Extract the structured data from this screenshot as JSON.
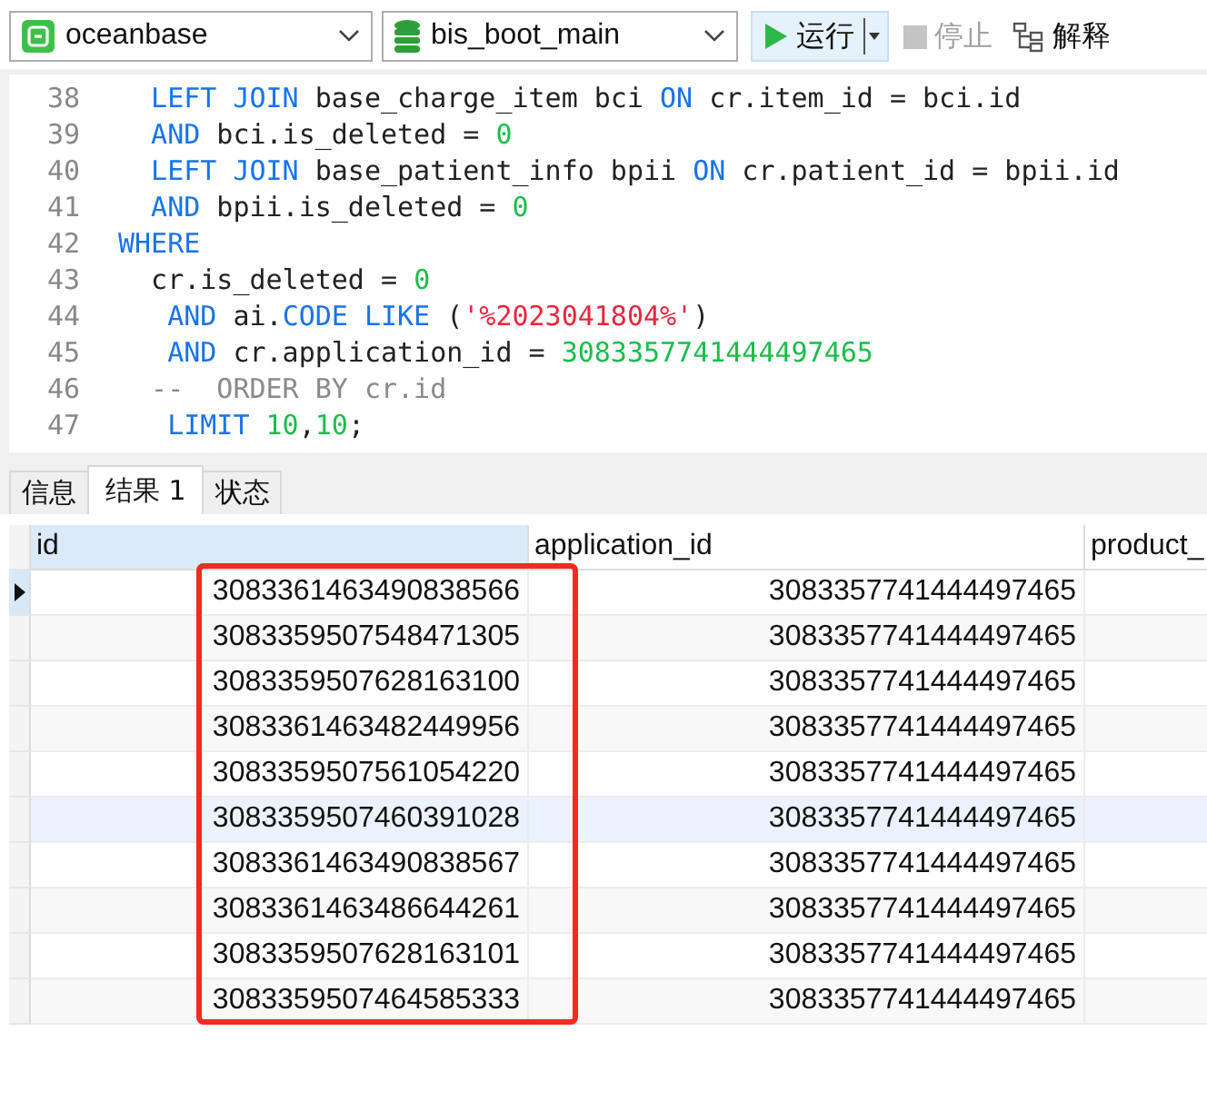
{
  "toolbar": {
    "connection": "oceanbase",
    "database": "bis_boot_main",
    "buttons": [
      {
        "kind": "run",
        "label": "运行",
        "disabled": false
      },
      {
        "kind": "stop",
        "label": "停止",
        "disabled": true
      },
      {
        "kind": "explain",
        "label": "解释",
        "disabled": false
      }
    ]
  },
  "editor": {
    "lines": [
      {
        "number": "38",
        "tokens": [
          {
            "kind": "kw",
            "text": "  LEFT JOIN"
          },
          {
            "kind": "plain",
            "text": " base_charge_item bci "
          },
          {
            "kind": "kw",
            "text": "ON"
          },
          {
            "kind": "plain",
            "text": " cr.item_id = bci.id"
          }
        ]
      },
      {
        "number": "39",
        "tokens": [
          {
            "kind": "kw",
            "text": "  AND"
          },
          {
            "kind": "plain",
            "text": " bci.is_deleted = "
          },
          {
            "kind": "num",
            "text": "0"
          }
        ]
      },
      {
        "number": "40",
        "tokens": [
          {
            "kind": "kw",
            "text": "  LEFT JOIN"
          },
          {
            "kind": "plain",
            "text": " base_patient_info bpii "
          },
          {
            "kind": "kw",
            "text": "ON"
          },
          {
            "kind": "plain",
            "text": " cr.patient_id = bpii.id"
          }
        ]
      },
      {
        "number": "41",
        "tokens": [
          {
            "kind": "kw",
            "text": "  AND"
          },
          {
            "kind": "plain",
            "text": " bpii.is_deleted = "
          },
          {
            "kind": "num",
            "text": "0"
          }
        ]
      },
      {
        "number": "42",
        "tokens": [
          {
            "kind": "kw",
            "text": "WHERE"
          }
        ]
      },
      {
        "number": "43",
        "tokens": [
          {
            "kind": "plain",
            "text": "  cr.is_deleted = "
          },
          {
            "kind": "num",
            "text": "0"
          }
        ]
      },
      {
        "number": "44",
        "tokens": [
          {
            "kind": "kw",
            "text": "   AND"
          },
          {
            "kind": "plain",
            "text": " ai."
          },
          {
            "kind": "kw",
            "text": "CODE LIKE"
          },
          {
            "kind": "plain",
            "text": " ("
          },
          {
            "kind": "str",
            "text": "'%2023041804%'"
          },
          {
            "kind": "plain",
            "text": ")"
          }
        ]
      },
      {
        "number": "45",
        "tokens": [
          {
            "kind": "kw",
            "text": "   AND"
          },
          {
            "kind": "plain",
            "text": " cr.application_id = "
          },
          {
            "kind": "num",
            "text": "3083357741444497465"
          }
        ]
      },
      {
        "number": "46",
        "tokens": [
          {
            "kind": "comment",
            "text": "  --  ORDER BY cr.id"
          }
        ]
      },
      {
        "number": "47",
        "tokens": [
          {
            "kind": "kw",
            "text": "   LIMIT "
          },
          {
            "kind": "num",
            "text": "10"
          },
          {
            "kind": "plain",
            "text": ","
          },
          {
            "kind": "num",
            "text": "10"
          },
          {
            "kind": "plain",
            "text": ";"
          }
        ]
      }
    ]
  },
  "tabs": [
    {
      "label": "信息",
      "selected": false
    },
    {
      "label": "结果 1",
      "selected": true
    },
    {
      "label": "状态",
      "selected": false
    }
  ],
  "table": {
    "columns": [
      {
        "label": "id",
        "selected": true
      },
      {
        "label": "application_id",
        "selected": false
      },
      {
        "label": "product_",
        "selected": false
      }
    ],
    "rows": [
      {
        "selected": true,
        "hovered": false,
        "cells": [
          "3083361463490838566",
          "3083357741444497465"
        ]
      },
      {
        "selected": false,
        "hovered": false,
        "cells": [
          "3083359507548471305",
          "3083357741444497465"
        ]
      },
      {
        "selected": false,
        "hovered": false,
        "cells": [
          "3083359507628163100",
          "3083357741444497465"
        ]
      },
      {
        "selected": false,
        "hovered": false,
        "cells": [
          "3083361463482449956",
          "3083357741444497465"
        ]
      },
      {
        "selected": false,
        "hovered": false,
        "cells": [
          "3083359507561054220",
          "3083357741444497465"
        ]
      },
      {
        "selected": false,
        "hovered": true,
        "cells": [
          "3083359507460391028",
          "3083357741444497465"
        ]
      },
      {
        "selected": false,
        "hovered": false,
        "cells": [
          "3083361463490838567",
          "3083357741444497465"
        ]
      },
      {
        "selected": false,
        "hovered": false,
        "cells": [
          "3083361463486644261",
          "3083357741444497465"
        ]
      },
      {
        "selected": false,
        "hovered": false,
        "cells": [
          "3083359507628163101",
          "3083357741444497465"
        ]
      },
      {
        "selected": false,
        "hovered": false,
        "cells": [
          "3083359507464585333",
          "3083357741444497465"
        ]
      }
    ]
  }
}
